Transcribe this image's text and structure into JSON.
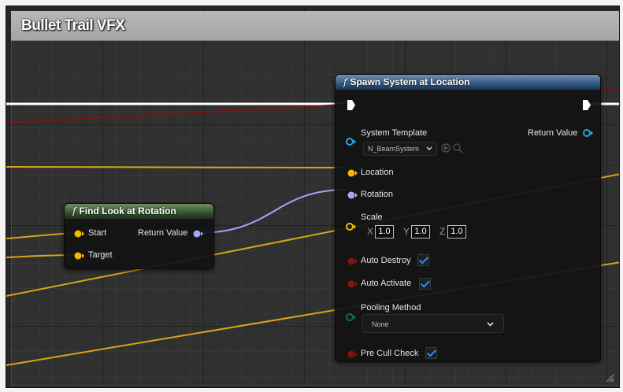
{
  "comment": {
    "title": "Bullet Trail VFX"
  },
  "find_look_at_rotation": {
    "title": "Find Look at Rotation",
    "inputs": [
      "Start",
      "Target"
    ],
    "output": "Return Value"
  },
  "spawn_system": {
    "title": "Spawn System at Location",
    "system_template": {
      "label": "System Template",
      "value": "N_BeamSystem"
    },
    "return_value": "Return Value",
    "location": "Location",
    "rotation": "Rotation",
    "scale": {
      "label": "Scale",
      "x_axis": "X",
      "x": "1.0",
      "y_axis": "Y",
      "y": "1.0",
      "z_axis": "Z",
      "z": "1.0"
    },
    "auto_destroy": {
      "label": "Auto Destroy",
      "checked": true
    },
    "auto_activate": {
      "label": "Auto Activate",
      "checked": true
    },
    "pooling_method": {
      "label": "Pooling Method",
      "value": "None"
    },
    "pre_cull_check": {
      "label": "Pre Cull Check",
      "checked": true
    }
  },
  "colors": {
    "exec_wire": "#ffffff",
    "vector_pin": "#f5b800",
    "rotator_pin": "#a0a8f5",
    "object_pin": "#1fa8e6",
    "bool_pin": "#8c0f0f",
    "enum_pin": "#0f6e5c",
    "checkbox_accent": "#2d8cff"
  }
}
